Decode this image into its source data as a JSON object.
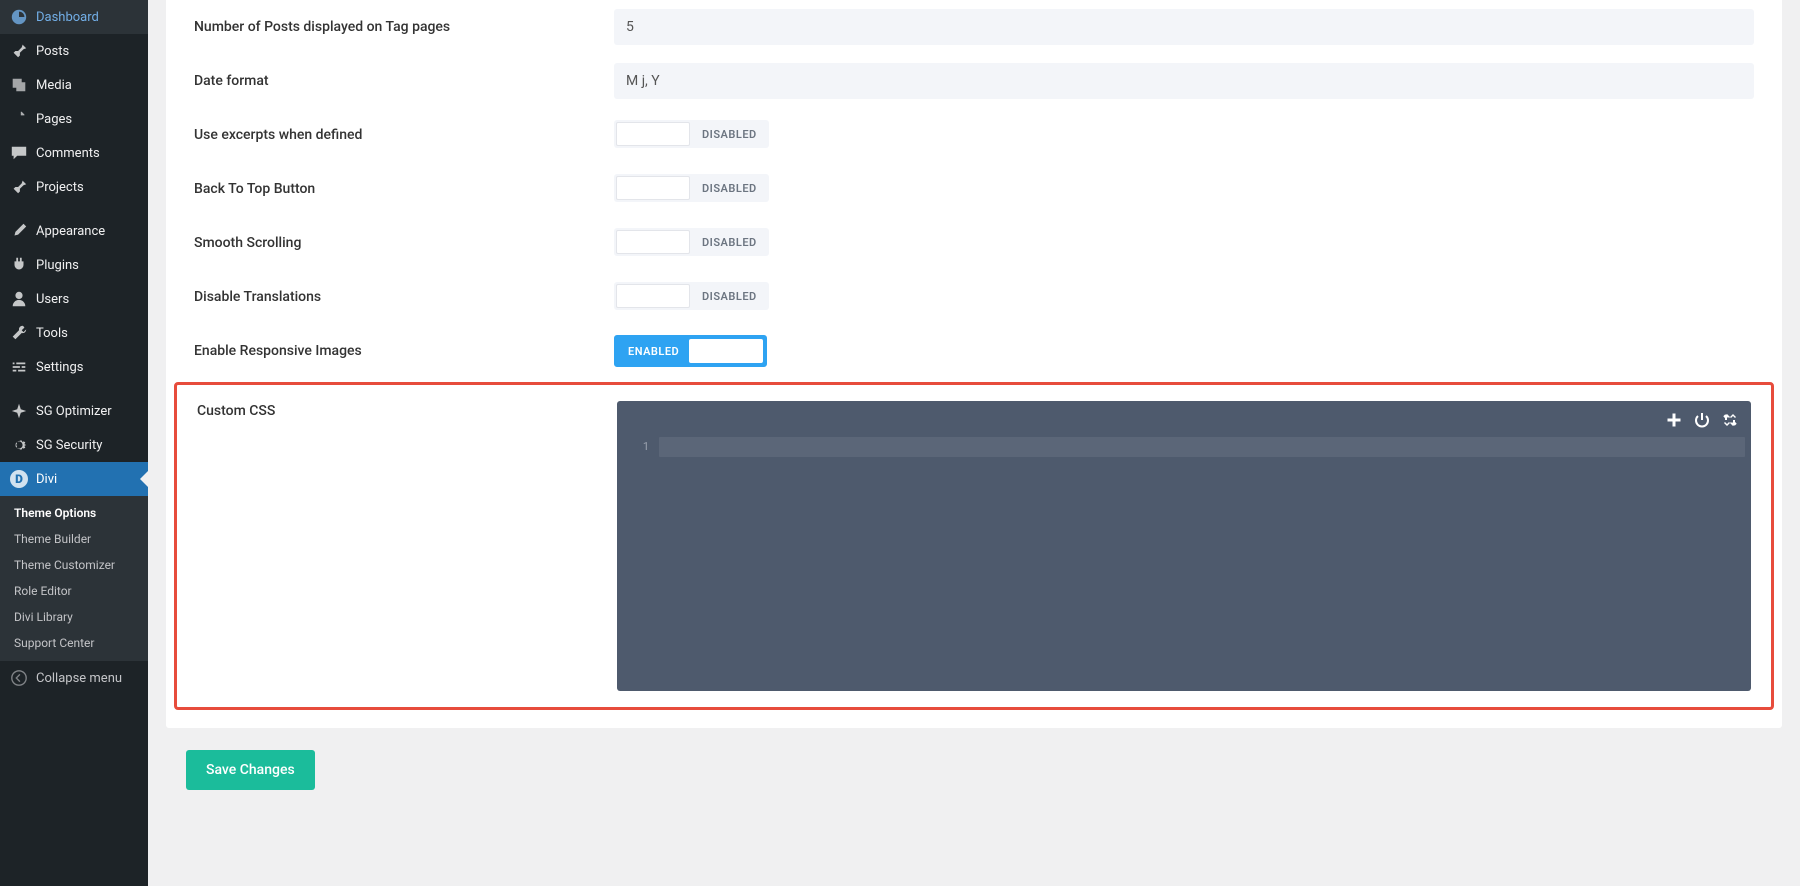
{
  "sidebar": {
    "items": [
      {
        "label": "Dashboard"
      },
      {
        "label": "Posts"
      },
      {
        "label": "Media"
      },
      {
        "label": "Pages"
      },
      {
        "label": "Comments"
      },
      {
        "label": "Projects"
      },
      {
        "label": "Appearance"
      },
      {
        "label": "Plugins"
      },
      {
        "label": "Users"
      },
      {
        "label": "Tools"
      },
      {
        "label": "Settings"
      },
      {
        "label": "SG Optimizer"
      },
      {
        "label": "SG Security"
      },
      {
        "label": "Divi"
      }
    ],
    "submenu": [
      {
        "label": "Theme Options"
      },
      {
        "label": "Theme Builder"
      },
      {
        "label": "Theme Customizer"
      },
      {
        "label": "Role Editor"
      },
      {
        "label": "Divi Library"
      },
      {
        "label": "Support Center"
      }
    ],
    "collapse_label": "Collapse menu"
  },
  "settings": {
    "tag_posts_label": "Number of Posts displayed on Tag pages",
    "tag_posts_value": "5",
    "date_format_label": "Date format",
    "date_format_value": "M j, Y",
    "use_excerpts_label": "Use excerpts when defined",
    "back_to_top_label": "Back To Top Button",
    "smooth_scroll_label": "Smooth Scrolling",
    "disable_translations_label": "Disable Translations",
    "responsive_images_label": "Enable Responsive Images",
    "custom_css_label": "Custom CSS",
    "disabled_text": "DISABLED",
    "enabled_text": "ENABLED",
    "line_number": "1"
  },
  "actions": {
    "save_label": "Save Changes"
  }
}
